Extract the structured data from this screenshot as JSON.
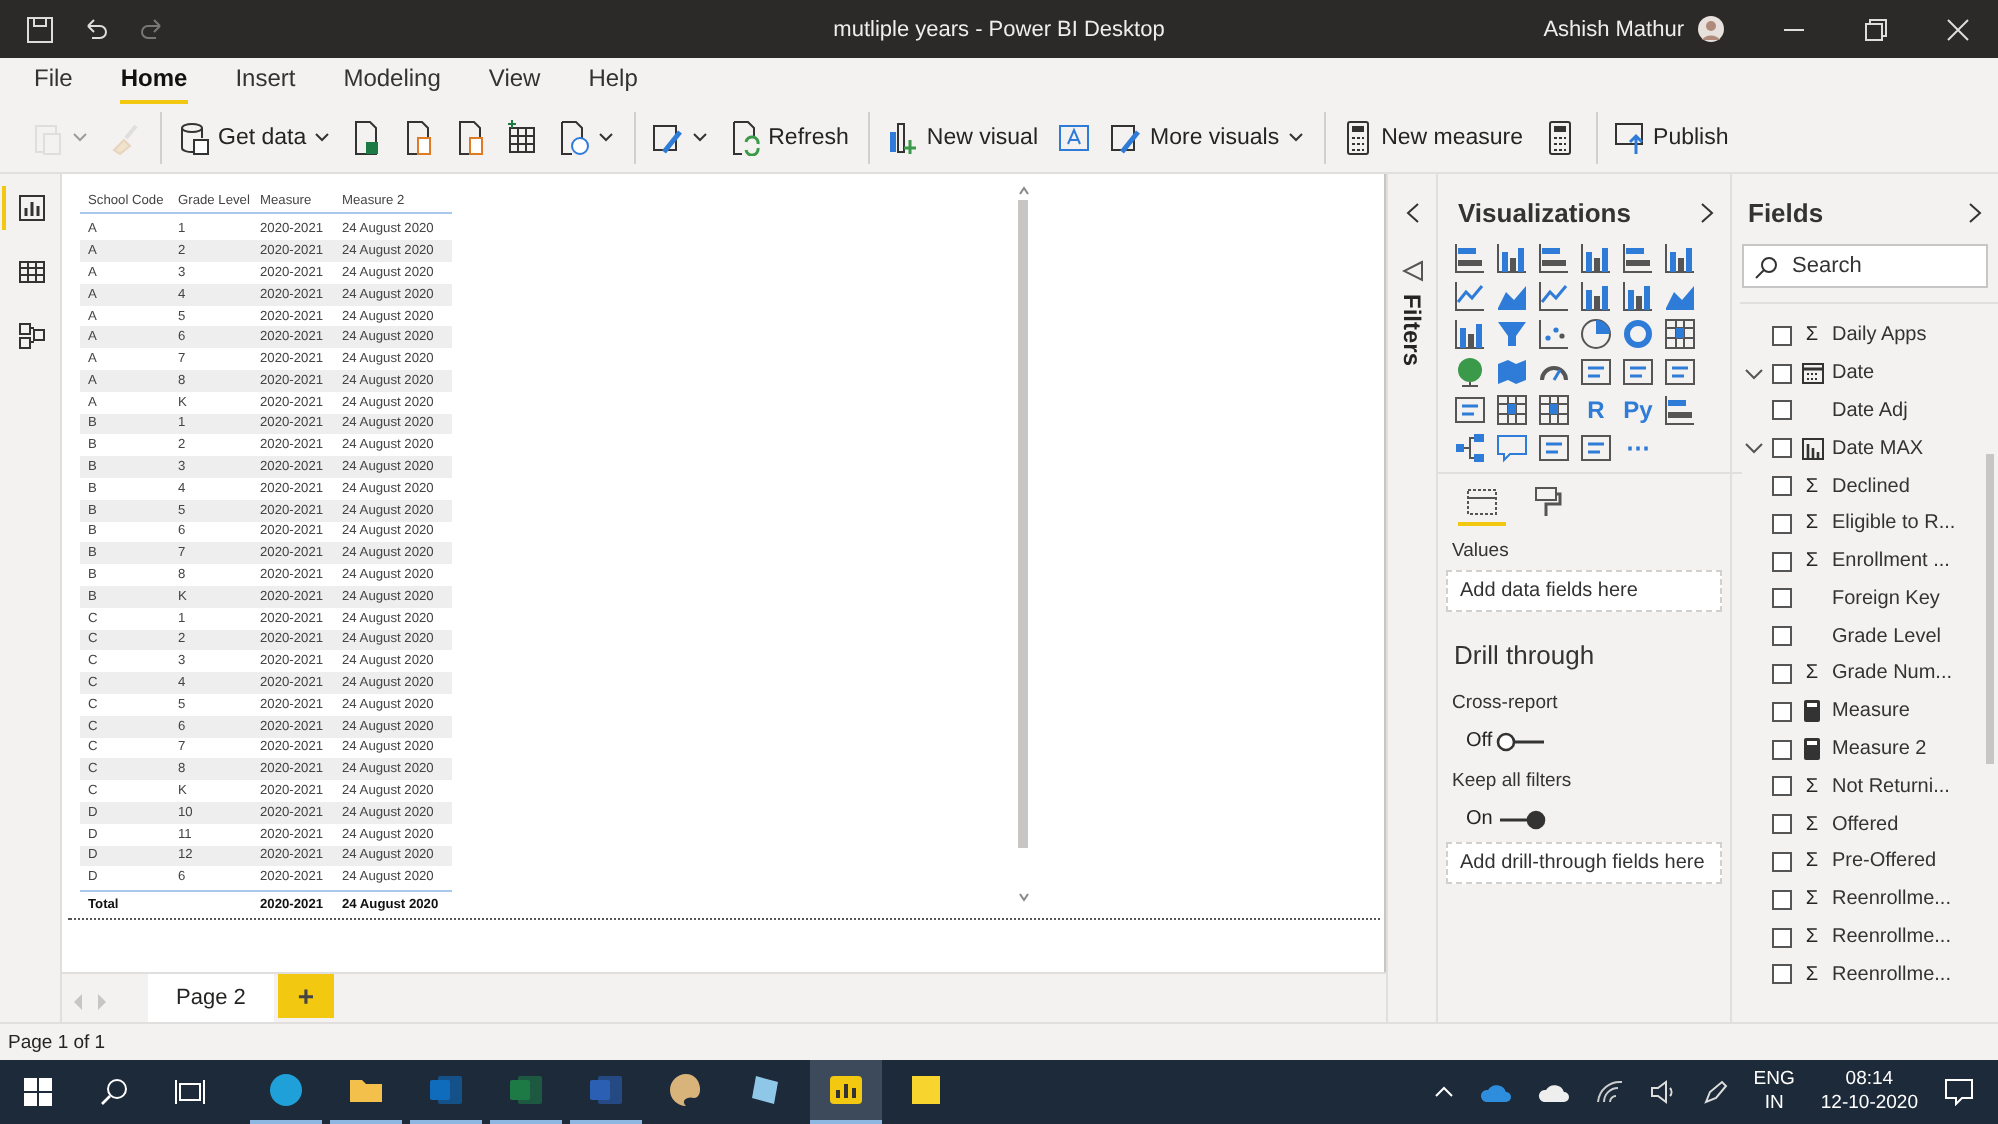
{
  "window": {
    "title": "mutliple years - Power BI Desktop",
    "user": "Ashish Mathur"
  },
  "menu_tabs": [
    {
      "label": "File",
      "selected": false
    },
    {
      "label": "Home",
      "selected": true
    },
    {
      "label": "Insert",
      "selected": false
    },
    {
      "label": "Modeling",
      "selected": false
    },
    {
      "label": "View",
      "selected": false
    },
    {
      "label": "Help",
      "selected": false
    }
  ],
  "ribbon": [
    [
      {
        "kind": "clipboard",
        "caret": true,
        "disabled": true
      },
      {
        "kind": "brush",
        "caret": false,
        "disabled": true
      }
    ],
    [
      {
        "kind": "database",
        "label": "Get data",
        "caret": true,
        "disabled": false
      },
      {
        "kind": "excel",
        "caret": false,
        "disabled": false
      },
      {
        "kind": "document",
        "caret": false,
        "disabled": false
      },
      {
        "kind": "document",
        "caret": false,
        "disabled": false
      },
      {
        "kind": "table",
        "caret": false,
        "disabled": false
      },
      {
        "kind": "clock",
        "caret": true,
        "disabled": false
      }
    ],
    [
      {
        "kind": "pencil",
        "caret": true,
        "disabled": false
      },
      {
        "kind": "refresh",
        "label": "Refresh",
        "caret": false,
        "disabled": false
      }
    ],
    [
      {
        "kind": "chart",
        "label": "New visual",
        "caret": false,
        "disabled": false
      },
      {
        "kind": "textbox",
        "caret": false,
        "disabled": false
      },
      {
        "kind": "pencil",
        "label": "More visuals",
        "caret": true,
        "disabled": false
      }
    ],
    [
      {
        "kind": "calculator",
        "label": "New measure",
        "caret": false,
        "disabled": false
      },
      {
        "kind": "calculator",
        "caret": false,
        "disabled": false
      }
    ],
    [
      {
        "kind": "publish",
        "label": "Publish",
        "caret": false,
        "disabled": false
      }
    ]
  ],
  "views": [
    {
      "kind": "report",
      "selected": true
    },
    {
      "kind": "data",
      "selected": false
    },
    {
      "kind": "model",
      "selected": false
    }
  ],
  "table": {
    "columns": [
      "School Code",
      "Grade Level",
      "Measure",
      "Measure 2"
    ],
    "rows": [
      [
        "A",
        "1",
        "2020-2021",
        "24 August 2020"
      ],
      [
        "A",
        "2",
        "2020-2021",
        "24 August 2020"
      ],
      [
        "A",
        "3",
        "2020-2021",
        "24 August 2020"
      ],
      [
        "A",
        "4",
        "2020-2021",
        "24 August 2020"
      ],
      [
        "A",
        "5",
        "2020-2021",
        "24 August 2020"
      ],
      [
        "A",
        "6",
        "2020-2021",
        "24 August 2020"
      ],
      [
        "A",
        "7",
        "2020-2021",
        "24 August 2020"
      ],
      [
        "A",
        "8",
        "2020-2021",
        "24 August 2020"
      ],
      [
        "A",
        "K",
        "2020-2021",
        "24 August 2020"
      ],
      [
        "B",
        "1",
        "2020-2021",
        "24 August 2020"
      ],
      [
        "B",
        "2",
        "2020-2021",
        "24 August 2020"
      ],
      [
        "B",
        "3",
        "2020-2021",
        "24 August 2020"
      ],
      [
        "B",
        "4",
        "2020-2021",
        "24 August 2020"
      ],
      [
        "B",
        "5",
        "2020-2021",
        "24 August 2020"
      ],
      [
        "B",
        "6",
        "2020-2021",
        "24 August 2020"
      ],
      [
        "B",
        "7",
        "2020-2021",
        "24 August 2020"
      ],
      [
        "B",
        "8",
        "2020-2021",
        "24 August 2020"
      ],
      [
        "B",
        "K",
        "2020-2021",
        "24 August 2020"
      ],
      [
        "C",
        "1",
        "2020-2021",
        "24 August 2020"
      ],
      [
        "C",
        "2",
        "2020-2021",
        "24 August 2020"
      ],
      [
        "C",
        "3",
        "2020-2021",
        "24 August 2020"
      ],
      [
        "C",
        "4",
        "2020-2021",
        "24 August 2020"
      ],
      [
        "C",
        "5",
        "2020-2021",
        "24 August 2020"
      ],
      [
        "C",
        "6",
        "2020-2021",
        "24 August 2020"
      ],
      [
        "C",
        "7",
        "2020-2021",
        "24 August 2020"
      ],
      [
        "C",
        "8",
        "2020-2021",
        "24 August 2020"
      ],
      [
        "C",
        "K",
        "2020-2021",
        "24 August 2020"
      ],
      [
        "D",
        "10",
        "2020-2021",
        "24 August 2020"
      ],
      [
        "D",
        "11",
        "2020-2021",
        "24 August 2020"
      ],
      [
        "D",
        "12",
        "2020-2021",
        "24 August 2020"
      ],
      [
        "D",
        "6",
        "2020-2021",
        "24 August 2020"
      ]
    ],
    "total": {
      "label": "Total",
      "cells": [
        "2020-2021",
        "24 August 2020"
      ]
    }
  },
  "page_tabs": [
    {
      "label": "Page 2",
      "selected": true
    }
  ],
  "add_page": "+",
  "filters": {
    "label": "Filters"
  },
  "visualizations": {
    "title": "Visualizations",
    "icons": [
      {
        "kind": "hbars"
      },
      {
        "kind": "vbars"
      },
      {
        "kind": "hbars"
      },
      {
        "kind": "vbars"
      },
      {
        "kind": "hbars"
      },
      {
        "kind": "vbars"
      },
      {
        "kind": "line"
      },
      {
        "kind": "area"
      },
      {
        "kind": "line"
      },
      {
        "kind": "vbars"
      },
      {
        "kind": "vbars"
      },
      {
        "kind": "area"
      },
      {
        "kind": "vbars"
      },
      {
        "kind": "funnel"
      },
      {
        "kind": "scatter"
      },
      {
        "kind": "pie"
      },
      {
        "kind": "donut"
      },
      {
        "kind": "grid"
      },
      {
        "kind": "globe"
      },
      {
        "kind": "map"
      },
      {
        "kind": "gauge"
      },
      {
        "kind": "card"
      },
      {
        "kind": "card"
      },
      {
        "kind": "card"
      },
      {
        "kind": "card"
      },
      {
        "kind": "grid"
      },
      {
        "kind": "grid"
      },
      {
        "kind": "glyph",
        "label": "R"
      },
      {
        "kind": "glyph",
        "label": "Py"
      },
      {
        "kind": "hbars"
      },
      {
        "kind": "tree"
      },
      {
        "kind": "speech"
      },
      {
        "kind": "card"
      },
      {
        "kind": "card"
      },
      {
        "kind": "glyph",
        "label": "⋯"
      }
    ],
    "panes": [
      {
        "kind": "fields",
        "selected": true
      },
      {
        "kind": "format",
        "selected": false
      }
    ],
    "values_label": "Values",
    "values_drop": "Add data fields here",
    "drill_title": "Drill through",
    "toggles": [
      {
        "label": "Cross-report",
        "state": "Off",
        "on": false
      },
      {
        "label": "Keep all filters",
        "state": "On",
        "on": true
      }
    ],
    "drill_drop": "Add drill-through fields here"
  },
  "fields": {
    "title": "Fields",
    "search": {
      "placeholder": "Search"
    },
    "items": [
      {
        "label": "Daily Apps",
        "kind": "field",
        "symbol": "Σ",
        "checked": false
      },
      {
        "label": "Date",
        "kind": "date",
        "expanded": true,
        "checked": false
      },
      {
        "label": "Date Adj",
        "kind": "field",
        "checked": false
      },
      {
        "label": "Date MAX",
        "kind": "hierarchy",
        "expanded": true,
        "checked": false
      },
      {
        "label": "Declined",
        "kind": "field",
        "symbol": "Σ",
        "checked": false
      },
      {
        "label": "Eligible to R...",
        "kind": "field",
        "symbol": "Σ",
        "checked": false
      },
      {
        "label": "Enrollment ...",
        "kind": "field",
        "symbol": "Σ",
        "checked": false
      },
      {
        "label": "Foreign Key",
        "kind": "field",
        "checked": false
      },
      {
        "label": "Grade Level",
        "kind": "field",
        "checked": false
      },
      {
        "label": "Grade Num...",
        "kind": "field",
        "symbol": "Σ",
        "checked": false
      },
      {
        "label": "Measure",
        "kind": "measure",
        "checked": false
      },
      {
        "label": "Measure 2",
        "kind": "measure",
        "checked": false
      },
      {
        "label": "Not Returni...",
        "kind": "field",
        "symbol": "Σ",
        "checked": false
      },
      {
        "label": "Offered",
        "kind": "field",
        "symbol": "Σ",
        "checked": false
      },
      {
        "label": "Pre-Offered",
        "kind": "field",
        "symbol": "Σ",
        "checked": false
      },
      {
        "label": "Reenrollme...",
        "kind": "field",
        "symbol": "Σ",
        "checked": false
      },
      {
        "label": "Reenrollme...",
        "kind": "field",
        "symbol": "Σ",
        "checked": false
      },
      {
        "label": "Reenrollme...",
        "kind": "field",
        "symbol": "Σ",
        "checked": false
      }
    ]
  },
  "status_bar": "Page 1 of 1",
  "taskbar": {
    "apps": [
      {
        "kind": "edge",
        "running": true,
        "selected": false
      },
      {
        "kind": "folder",
        "running": true,
        "selected": false
      },
      {
        "kind": "outlook",
        "running": true,
        "selected": false
      },
      {
        "kind": "excel",
        "running": true,
        "selected": false
      },
      {
        "kind": "word",
        "running": true,
        "selected": false
      },
      {
        "kind": "palette",
        "running": false,
        "selected": false
      },
      {
        "kind": "notebook",
        "running": false,
        "selected": false
      },
      {
        "kind": "powerbi",
        "running": true,
        "selected": true
      },
      {
        "kind": "note",
        "running": false,
        "selected": false
      }
    ],
    "language": "ENG",
    "region": "IN",
    "time": "08:14",
    "date": "12-10-2020"
  }
}
